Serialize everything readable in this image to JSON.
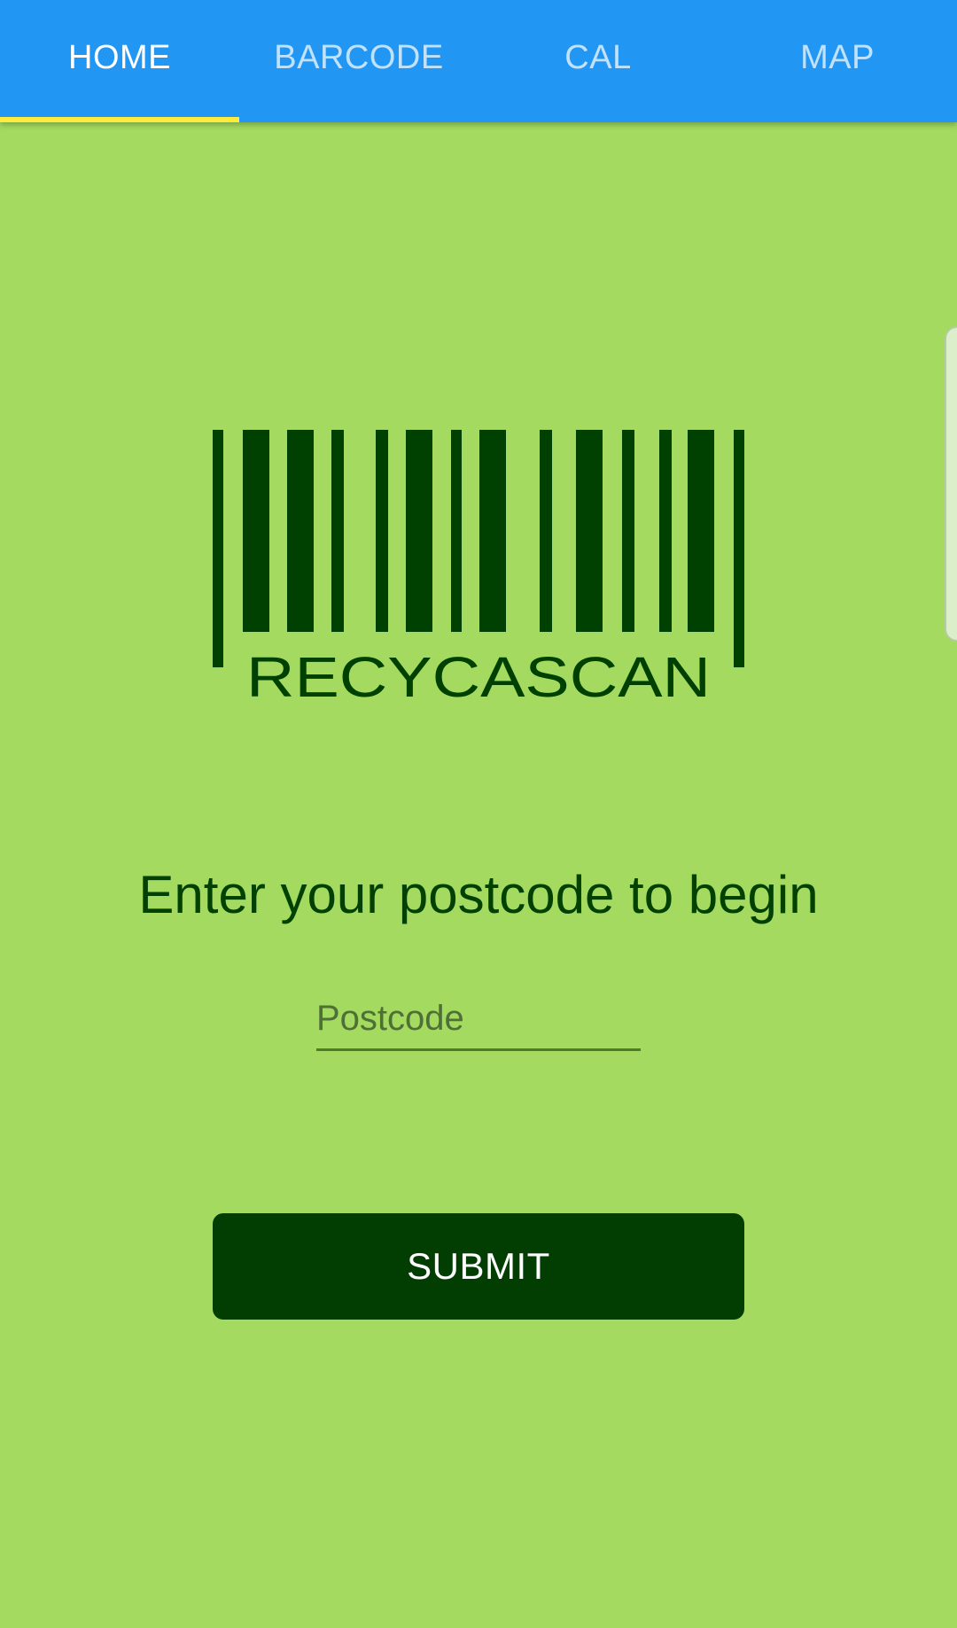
{
  "tabs": [
    {
      "label": "HOME",
      "active": true
    },
    {
      "label": "BARCODE",
      "active": false
    },
    {
      "label": "CAL",
      "active": false
    },
    {
      "label": "MAP",
      "active": false
    }
  ],
  "logo": {
    "wordmark": "RECYCASCAN",
    "color": "#004000"
  },
  "main": {
    "prompt": "Enter your postcode to begin",
    "postcode": {
      "value": "",
      "placeholder": "Postcode"
    },
    "submit_label": "SUBMIT"
  },
  "colors": {
    "tab_bar": "#2196f3",
    "tab_indicator": "#ffeb3b",
    "background": "#a3da5f",
    "dark_green": "#023d02"
  }
}
